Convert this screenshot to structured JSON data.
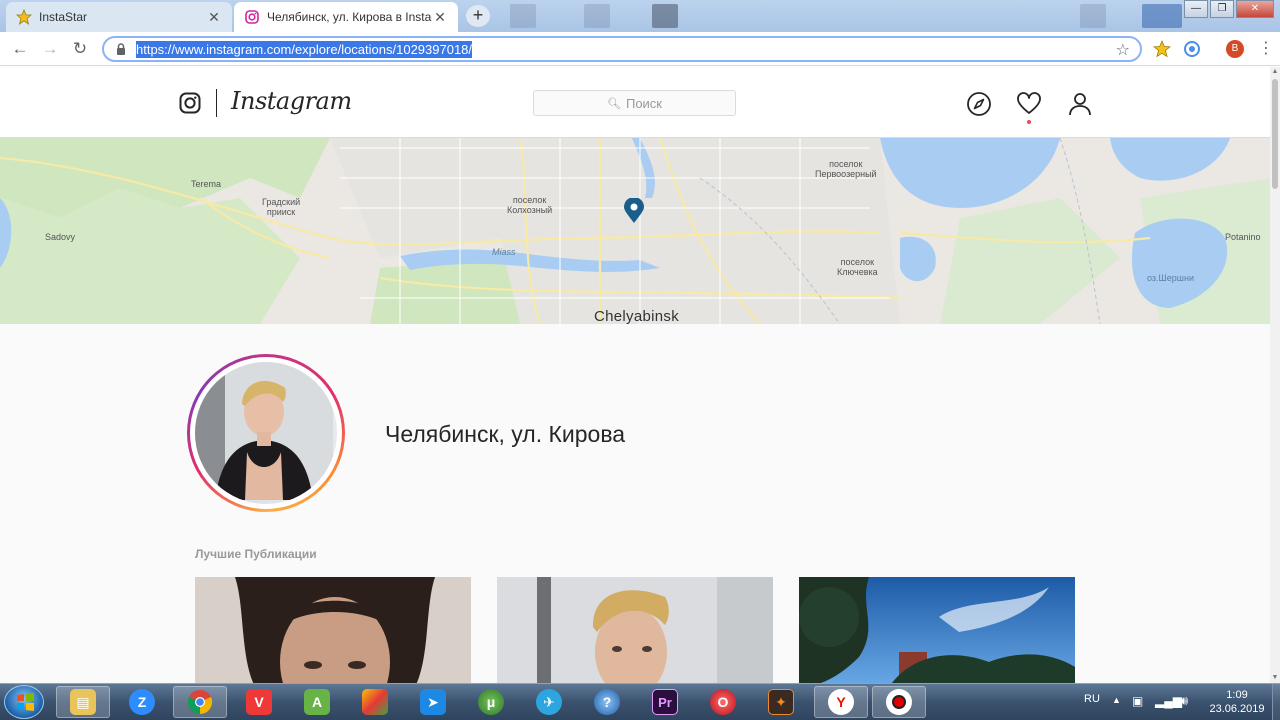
{
  "browser": {
    "tabs": [
      {
        "title": "InstaStar",
        "active": false
      },
      {
        "title": "Челябинск, ул. Кирова в Instagr",
        "active": true
      }
    ],
    "url": "https://www.instagram.com/explore/locations/1029397018/",
    "profile_initial": "B"
  },
  "instagram": {
    "wordmark": "Instagram",
    "search_placeholder": "Поиск",
    "map": {
      "city": "Chelyabinsk",
      "labels": {
        "terema": "Terema",
        "gradsky_1": "Градский",
        "gradsky_2": "прииск",
        "sadovy": "Sadovy",
        "kolkhozny_1": "поселок",
        "kolkhozny_2": "Колхозный",
        "miass": "Miass",
        "pervoozerny_1": "поселок",
        "pervoozerny_2": "Первоозерный",
        "klyuchevka_1": "поселок",
        "klyuchevka_2": "Ключевка",
        "potanino": "Potanino",
        "shershni": "оз.Шершни"
      }
    },
    "location_name": "Челябинск, ул. Кирова",
    "section_title": "Лучшие Публикации"
  },
  "taskbar": {
    "language": "RU",
    "time": "1:09",
    "date": "23.06.2019",
    "apps": [
      "explorer",
      "zoom",
      "chrome",
      "vivaldi",
      "adguard",
      "files",
      "teamviewer",
      "utorrent",
      "telegram",
      "help",
      "premiere",
      "opera",
      "camtasia",
      "yandex",
      "recorder"
    ],
    "premiere_label": "Pr"
  },
  "colors": {
    "ig_ring": "#e1306c",
    "url_highlight": "#3b78e7",
    "map_pin": "#1a5e8c",
    "notification_dot": "#ed4956"
  }
}
